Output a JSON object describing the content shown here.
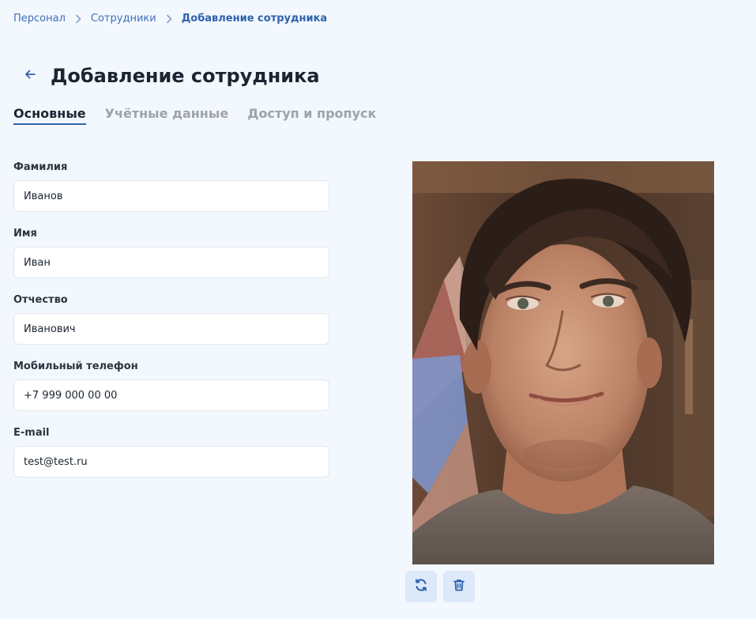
{
  "breadcrumb": {
    "items": [
      "Персонал",
      "Сотрудники"
    ],
    "current": "Добавление сотрудника"
  },
  "header": {
    "title": "Добавление сотрудника"
  },
  "tabs": [
    {
      "label": "Основные",
      "active": true
    },
    {
      "label": "Учётные данные",
      "active": false
    },
    {
      "label": "Доступ и пропуск",
      "active": false
    }
  ],
  "form": {
    "last_name": {
      "label": "Фамилия",
      "value": "Иванов"
    },
    "first_name": {
      "label": "Имя",
      "value": "Иван"
    },
    "patronymic": {
      "label": "Отчество",
      "value": "Иванович"
    },
    "phone": {
      "label": "Мобильный телефон",
      "value": "+7 999 000 00 00"
    },
    "email": {
      "label": "E-mail",
      "value": "test@test.ru"
    }
  },
  "photo_actions": {
    "refresh_icon": "refresh-icon",
    "delete_icon": "trash-icon"
  },
  "colors": {
    "background": "#f3f8fe",
    "accent": "#2e62ad",
    "link": "#3f6fb8",
    "button_bg": "#dde9fa",
    "muted_tab": "#9ea3ab"
  }
}
